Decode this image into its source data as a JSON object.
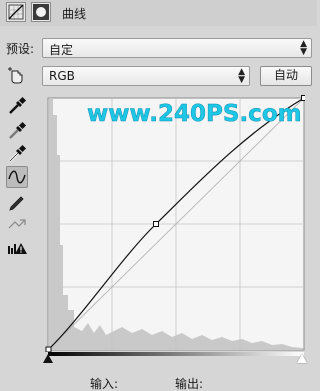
{
  "panel": {
    "title": "曲线"
  },
  "preset": {
    "label": "预设:",
    "value": "自定"
  },
  "channel": {
    "value": "RGB"
  },
  "auto_button": {
    "label": "自动"
  },
  "watermark": {
    "text": "www.240PS.com"
  },
  "io": {
    "input_label": "输入:",
    "output_label": "输出:"
  },
  "colors": {
    "watermark": "#1fc7e6",
    "panel_bg": "#d6d6d6",
    "graph_bg": "#f5f5f5"
  },
  "curve": {
    "points": [
      [
        0,
        0
      ],
      [
        128,
        150
      ],
      [
        255,
        255
      ]
    ],
    "range": [
      0,
      255
    ]
  },
  "histogram": {
    "description": "luminance histogram with tall peak near black and low spread across midtones"
  },
  "tools": [
    {
      "name": "on-image-adjust",
      "icon": "hand-pointer-icon"
    },
    {
      "name": "black-point",
      "icon": "eyedropper-black-icon"
    },
    {
      "name": "gray-point",
      "icon": "eyedropper-gray-icon"
    },
    {
      "name": "white-point",
      "icon": "eyedropper-white-icon"
    },
    {
      "name": "edit-points",
      "icon": "curve-icon"
    },
    {
      "name": "draw-curve",
      "icon": "pencil-icon"
    },
    {
      "name": "smooth",
      "icon": "smooth-icon"
    },
    {
      "name": "clipping",
      "icon": "clipping-warning-icon"
    }
  ]
}
